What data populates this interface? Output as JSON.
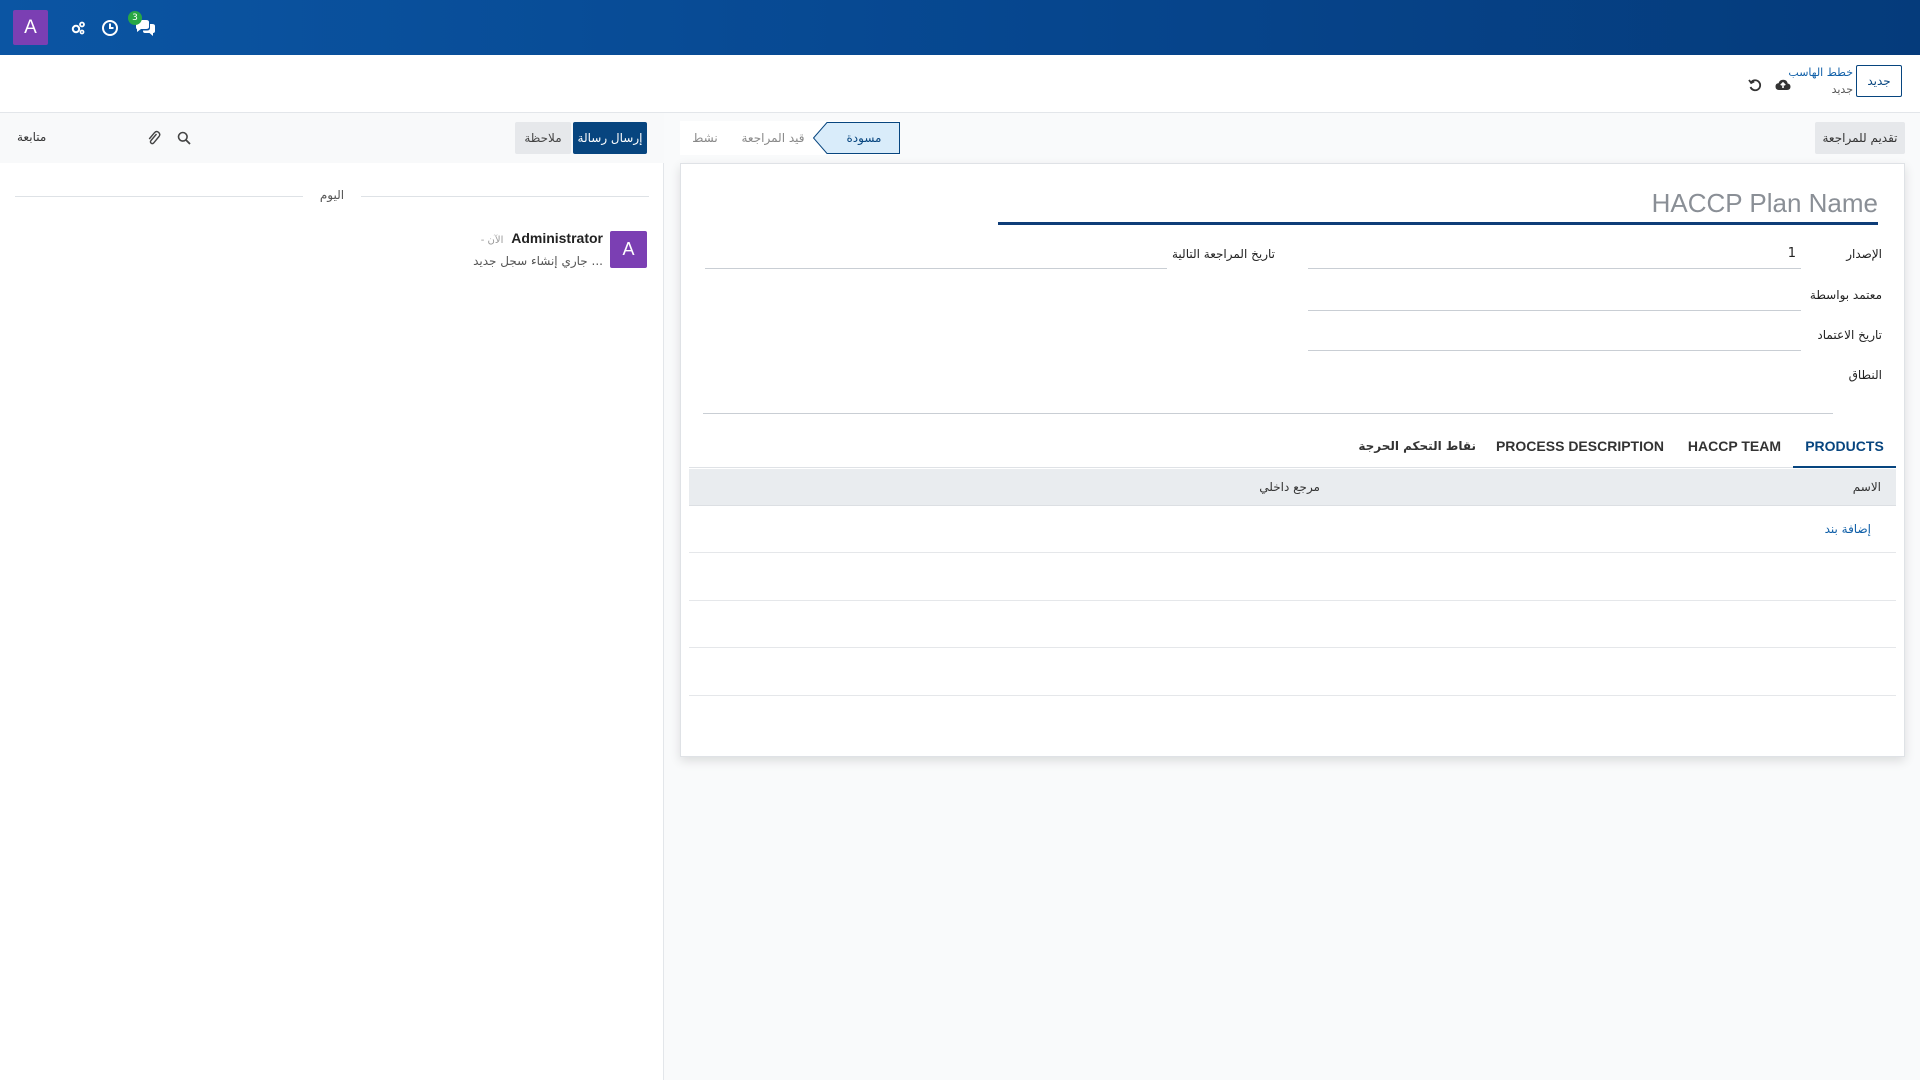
{
  "navbar": {
    "avatar_letter": "A",
    "messages_badge": "3",
    "icons": [
      "settings-icon",
      "clock-icon",
      "chat-icon"
    ]
  },
  "control_panel": {
    "new_button": "جديد",
    "breadcrumb_parent": "خطط الهاسب",
    "breadcrumb_current": "جديد"
  },
  "chatter": {
    "send_message": "إرسال رسالة",
    "log_note": "ملاحظة",
    "follow": "متابعة",
    "day": "اليوم",
    "message": {
      "avatar_letter": "A",
      "author": "Administrator",
      "time": "- الآن",
      "body": "جاري إنشاء سجل جديد ..."
    }
  },
  "statusbar": {
    "submit_button": "تقديم للمراجعة",
    "stages": [
      "مسودة",
      "قيد المراجعة",
      "نشط"
    ],
    "active_stage": "مسودة"
  },
  "form": {
    "title_placeholder": "HACCP Plan Name",
    "fields": {
      "version_label": "الإصدار",
      "version_value": "1",
      "approved_by_label": "معتمد بواسطة",
      "approval_date_label": "تاريخ الاعتماد",
      "scope_label": "النطاق",
      "next_review_label": "تاريخ المراجعة التالية"
    },
    "tabs": [
      "PRODUCTS",
      "HACCP TEAM",
      "PROCESS DESCRIPTION",
      "نقاط التحكم الحرجة"
    ],
    "active_tab": "PRODUCTS",
    "list": {
      "columns": [
        "الاسم",
        "مرجع داخلي"
      ],
      "add_line": "إضافة بند",
      "rows": []
    }
  },
  "colors": {
    "navbar": "#06468e",
    "primary": "#07457f",
    "avatar": "#7b3fb3",
    "badge": "#28a745"
  }
}
